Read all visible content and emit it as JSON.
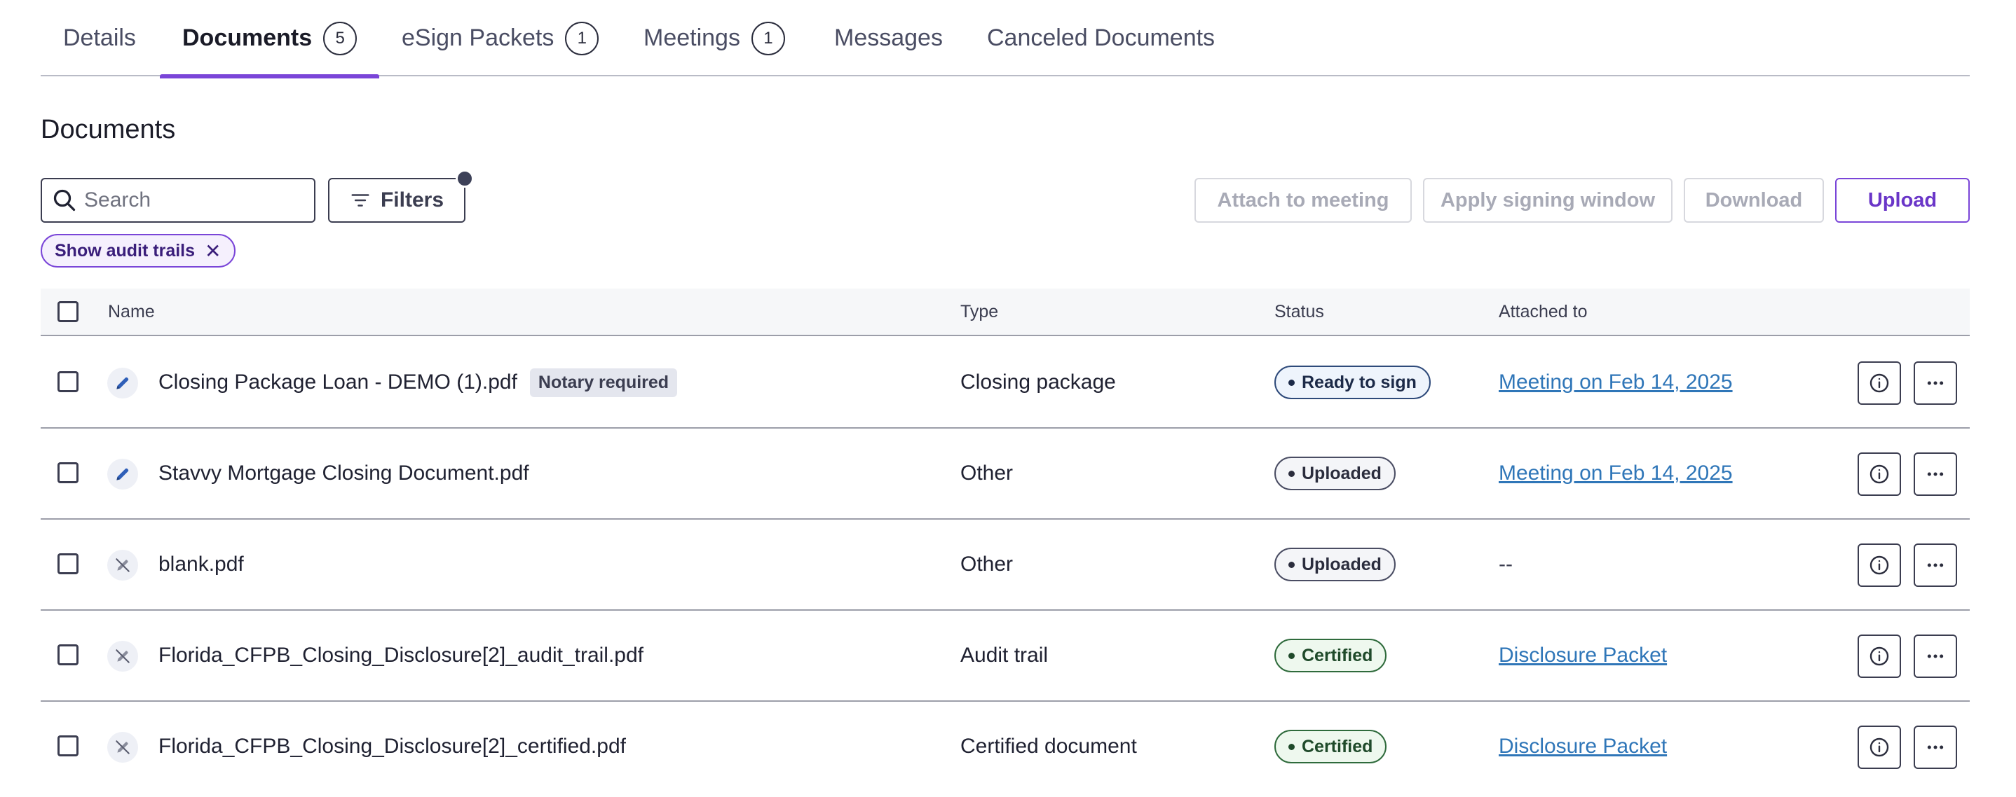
{
  "tabs": [
    {
      "label": "Details",
      "count": null,
      "active": false
    },
    {
      "label": "Documents",
      "count": "5",
      "active": true
    },
    {
      "label": "eSign Packets",
      "count": "1",
      "active": false
    },
    {
      "label": "Meetings",
      "count": "1",
      "active": false
    },
    {
      "label": "Messages",
      "count": null,
      "active": false
    },
    {
      "label": "Canceled Documents",
      "count": null,
      "active": false
    }
  ],
  "section_title": "Documents",
  "toolbar": {
    "search_placeholder": "Search",
    "search_value": "",
    "filters_label": "Filters",
    "attach_label": "Attach to meeting",
    "signing_window_label": "Apply signing window",
    "download_label": "Download",
    "upload_label": "Upload"
  },
  "active_filter_chip": "Show audit trails",
  "chip_close_glyph": "✕",
  "table": {
    "headers": {
      "name": "Name",
      "type": "Type",
      "status": "Status",
      "attached_to": "Attached to"
    },
    "rows": [
      {
        "icon": "pencil-icon",
        "name": "Closing Package Loan - DEMO (1).pdf",
        "badge": "Notary required",
        "type": "Closing package",
        "status": "Ready to sign",
        "status_color": "blue",
        "attached_to": "Meeting on Feb 14, 2025",
        "attached_is_link": true
      },
      {
        "icon": "pencil-icon",
        "name": "Stavvy Mortgage Closing Document.pdf",
        "badge": "",
        "type": "Other",
        "status": "Uploaded",
        "status_color": "gray",
        "attached_to": "Meeting on Feb 14, 2025",
        "attached_is_link": true
      },
      {
        "icon": "pencil-off-icon",
        "name": "blank.pdf",
        "badge": "",
        "type": "Other",
        "status": "Uploaded",
        "status_color": "gray",
        "attached_to": "--",
        "attached_is_link": false
      },
      {
        "icon": "pencil-off-icon",
        "name": "Florida_CFPB_Closing_Disclosure[2]_audit_trail.pdf",
        "badge": "",
        "type": "Audit trail",
        "status": "Certified",
        "status_color": "green",
        "attached_to": "Disclosure Packet",
        "attached_is_link": true
      },
      {
        "icon": "pencil-off-icon",
        "name": "Florida_CFPB_Closing_Disclosure[2]_certified.pdf",
        "badge": "",
        "type": "Certified document",
        "status": "Certified",
        "status_color": "green",
        "attached_to": "Disclosure Packet",
        "attached_is_link": true
      }
    ]
  },
  "colors": {
    "accent": "#7a45d8",
    "link": "#2f76b8",
    "ready_blue": "#2e4a7a",
    "certified_green": "#2f6b3c"
  }
}
